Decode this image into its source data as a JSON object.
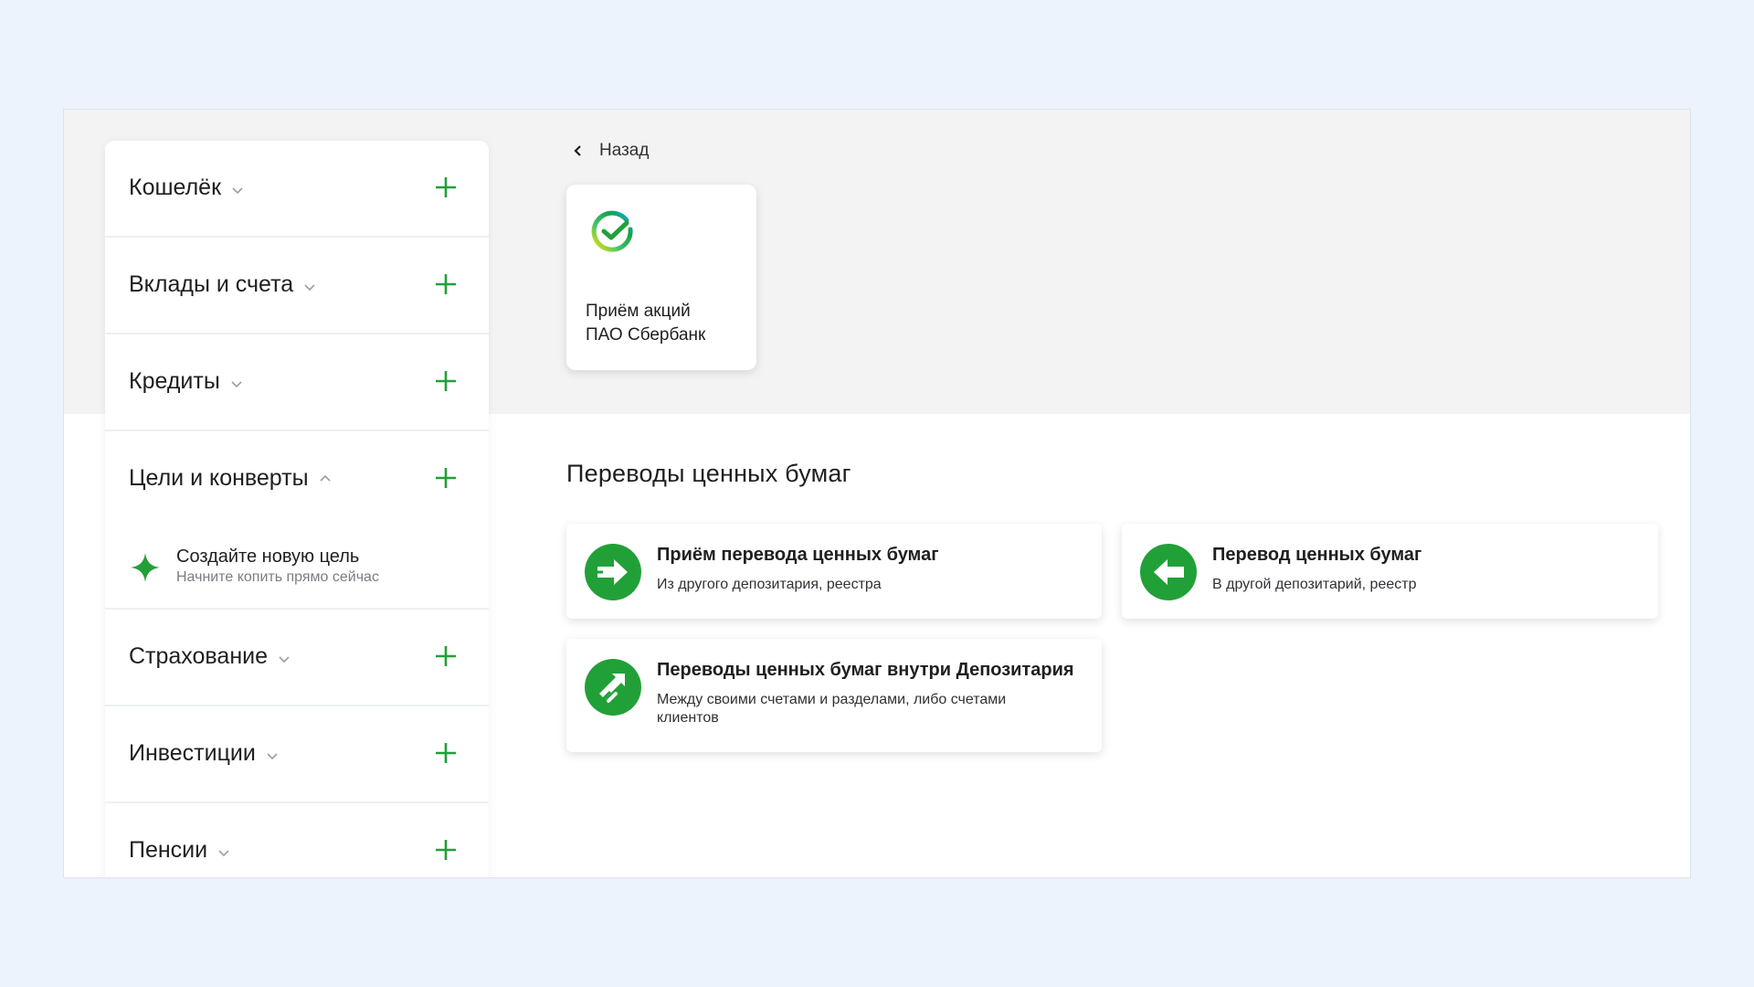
{
  "sidebar": {
    "items": [
      {
        "label": "Кошелёк"
      },
      {
        "label": "Вклады и счета"
      },
      {
        "label": "Кредиты"
      },
      {
        "label": "Цели и конверты",
        "goal": {
          "title": "Создайте новую цель",
          "subtitle": "Начните копить прямо сейчас"
        }
      },
      {
        "label": "Страхование"
      },
      {
        "label": "Инвестиции"
      },
      {
        "label": "Пенсии"
      }
    ]
  },
  "header": {
    "back_label": "Назад"
  },
  "share_card": {
    "title": "Приём акций\nПАО Сбербанк",
    "icon": "sber-logo"
  },
  "transfers": {
    "section_title": "Переводы ценных бумаг",
    "cards": [
      {
        "title": "Приём перевода ценных бумаг",
        "subtitle": "Из другого депозитария, реестра",
        "icon": "arrow-right-icon"
      },
      {
        "title": "Перевод ценных бумаг",
        "subtitle": "В другой депозитарий, реестр",
        "icon": "arrow-left-icon"
      },
      {
        "title": "Переводы ценных бумаг внутри Депозитария",
        "subtitle": "Между своими счетами и разделами, либо счетами клиентов",
        "icon": "exchange-icon"
      }
    ]
  },
  "colors": {
    "accent": "#21a038",
    "background": "#edf3fc",
    "band": "#f3f3f3"
  }
}
